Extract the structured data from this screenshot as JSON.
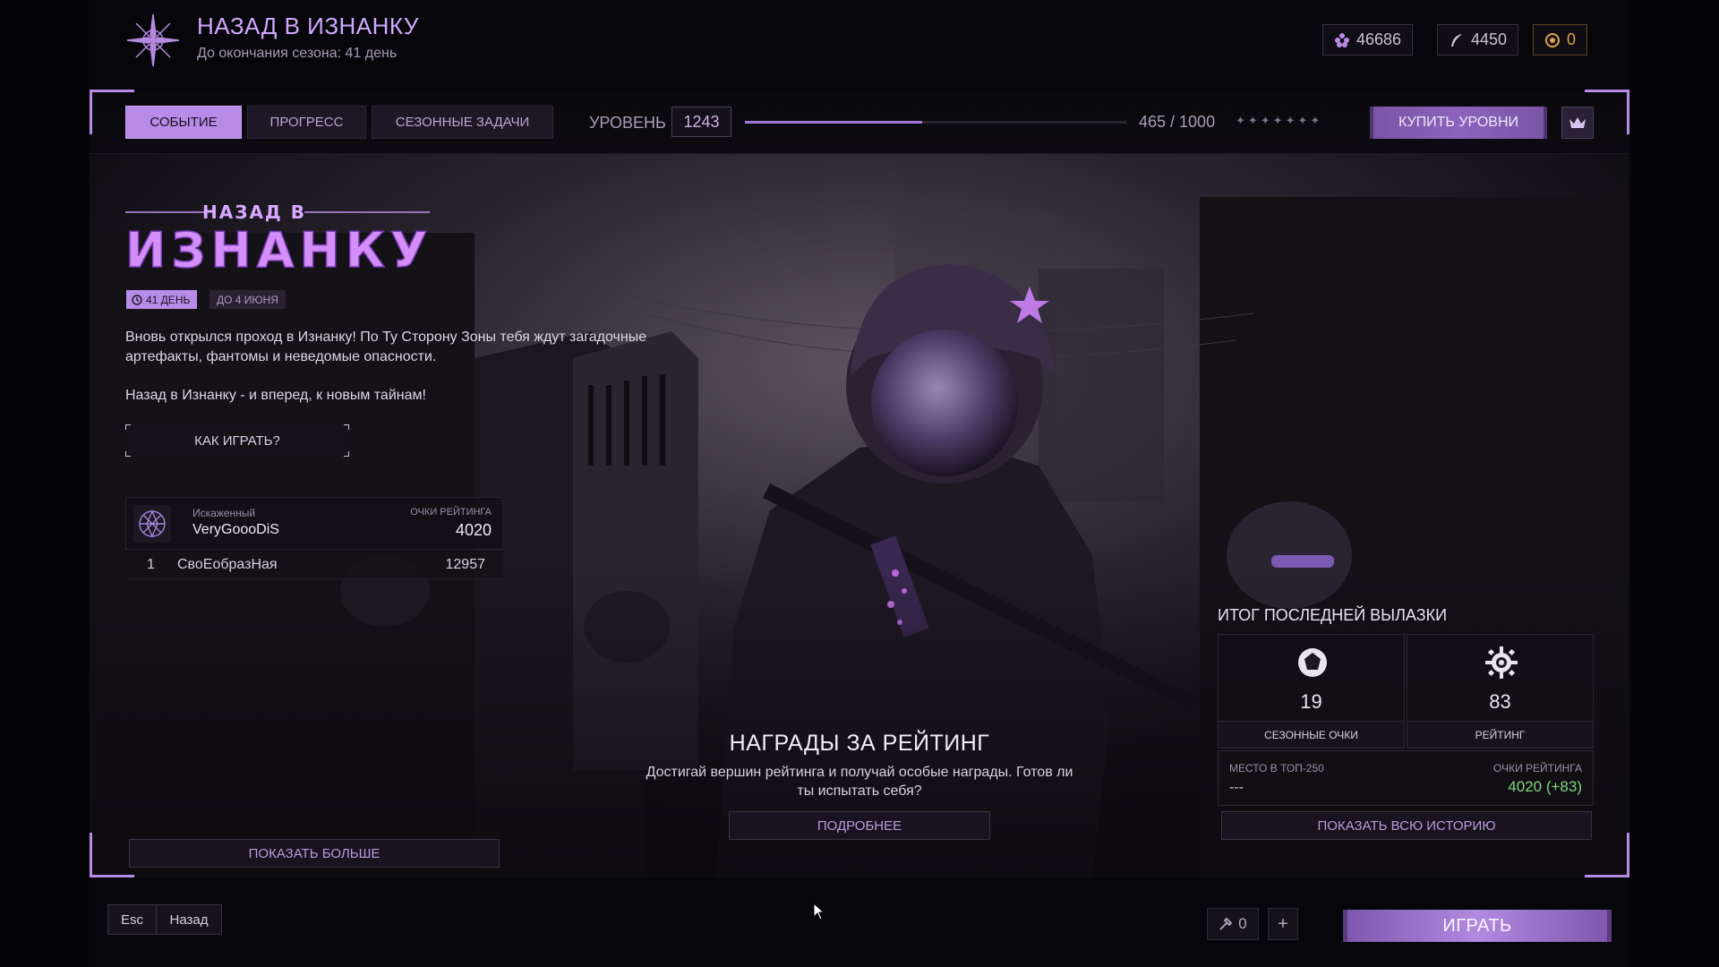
{
  "header": {
    "title": "НАЗАД В ИЗНАНКУ",
    "subtitle": "До окончания сезона: 41 день",
    "currencies": [
      {
        "icon": "artifact-icon",
        "value": "46686"
      },
      {
        "icon": "feather-icon",
        "value": "4450"
      },
      {
        "icon": "coin-icon",
        "value": "0"
      }
    ]
  },
  "topbar": {
    "tabs": [
      "СОБЫТИЕ",
      "ПРОГРЕСС",
      "СЕЗОННЫЕ ЗАДАЧИ"
    ],
    "active_tab": "СОБЫТИЕ",
    "level_label": "УРОВЕНЬ",
    "level_value": "1243",
    "progress_text": "465 / 1000",
    "progress_fraction": 0.465,
    "buy_levels_label": "КУПИТЬ УРОВНИ"
  },
  "event": {
    "logo_line1": "НАЗАД В",
    "logo_line2": "ИЗНАНКУ",
    "days_badge": "41 ДЕНЬ",
    "date_badge": "ДО 4 ИЮНЯ",
    "description_1": "Вновь открылся проход в Изнанку! По Ту Сторону Зоны тебя ждут загадочные артефакты, фантомы и неведомые опасности.",
    "description_2": "Назад в Изнанку - и вперед, к новым тайнам!",
    "how_to_play": "КАК ИГРАТЬ?"
  },
  "rating": {
    "faction": "Искаженный",
    "player_name": "VeryGoooDiS",
    "points_label": "ОЧКИ РЕЙТИНГА",
    "points": "4020",
    "leaders": [
      {
        "position": "1",
        "name": "СвоЕобразНая",
        "score": "12957"
      }
    ],
    "show_more": "ПОКАЗАТЬ БОЛЬШЕ"
  },
  "rewards": {
    "title": "НАГРАДЫ ЗА РЕЙТИНГ",
    "description": "Достигай вершин рейтинга и получай особые награды. Готов ли ты испытать себя?",
    "details_button": "ПОДРОБНЕЕ"
  },
  "last_raid": {
    "title": "ИТОГ ПОСЛЕДНЕЙ ВЫЛАЗКИ",
    "season_points_value": "19",
    "season_points_label": "СЕЗОННЫЕ ОЧКИ",
    "rating_value": "83",
    "rating_label": "РЕЙТИНГ",
    "top_place_label": "МЕСТО В ТОП-250",
    "top_place_value": "---",
    "rating_points_label": "ОЧКИ РЕЙТИНГА",
    "rating_points_value": "4020 (+83)",
    "history_button": "ПОКАЗАТЬ ВСЮ ИСТОРИЮ"
  },
  "footer": {
    "esc_key": "Esc",
    "back_label": "Назад",
    "tools_count": "0",
    "plus": "+",
    "play_label": "ИГРАТЬ"
  },
  "colors": {
    "accent": "#b98be8",
    "positive": "#7fd67a",
    "background": "#050407"
  }
}
